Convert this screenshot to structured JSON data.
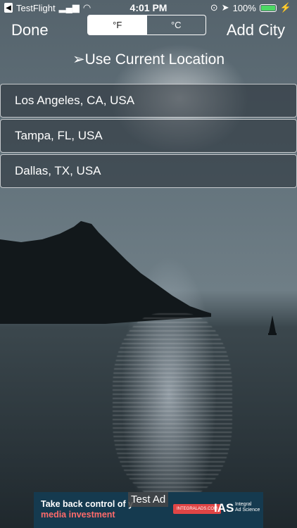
{
  "status_bar": {
    "back_app": "TestFlight",
    "time": "4:01 PM",
    "battery": "100%",
    "battery_level": 1.0
  },
  "nav": {
    "done_label": "Done",
    "add_city_label": "Add City",
    "units": [
      {
        "label": "°F",
        "selected": true
      },
      {
        "label": "°C",
        "selected": false
      }
    ]
  },
  "use_current_location": "➢Use Current Location",
  "cities": [
    {
      "name": "Los Angeles, CA, USA"
    },
    {
      "name": "Tampa, FL, USA"
    },
    {
      "name": "Dallas, TX, USA"
    }
  ],
  "ad": {
    "badge": "Test Ad",
    "line1": "Take back control of y",
    "line2": "media investment",
    "site": "INTEGRALADS.COM",
    "brand": "IAS",
    "brand_sub1": "Integral",
    "brand_sub2": "Ad Science"
  }
}
